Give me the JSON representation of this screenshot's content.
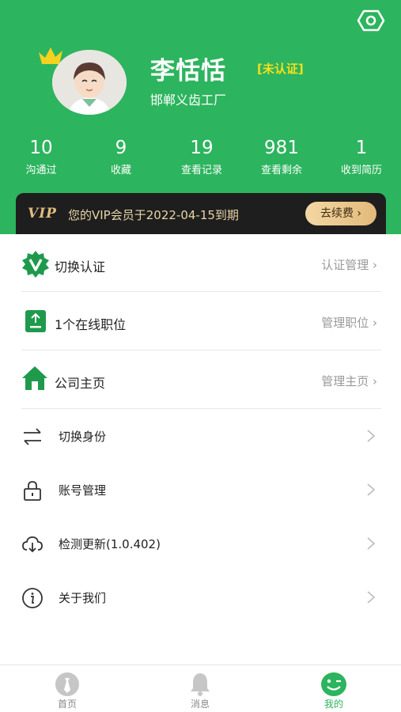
{
  "profile": {
    "name": "李恬恬",
    "cert_status": "[未认证]",
    "company": "邯郸义齿工厂"
  },
  "stats": [
    {
      "value": "10",
      "label": "沟通过"
    },
    {
      "value": "9",
      "label": "收藏"
    },
    {
      "value": "19",
      "label": "查看记录"
    },
    {
      "value": "981",
      "label": "查看剩余"
    },
    {
      "value": "1",
      "label": "收到简历"
    }
  ],
  "vip": {
    "logo": "VIP",
    "text": "您的VIP会员于2022-04-15到期",
    "renew_label": "去续费"
  },
  "menu_primary": [
    {
      "label": "切换认证",
      "right": "认证管理"
    },
    {
      "label": "1个在线职位",
      "right": "管理职位"
    },
    {
      "label": "公司主页",
      "right": "管理主页"
    }
  ],
  "menu_secondary": [
    {
      "label": "切换身份"
    },
    {
      "label": "账号管理"
    },
    {
      "label": "检测更新(1.0.402)"
    },
    {
      "label": "关于我们"
    }
  ],
  "tabs": [
    {
      "label": "首页"
    },
    {
      "label": "消息"
    },
    {
      "label": "我的"
    }
  ],
  "colors": {
    "brand_green": "#2db45e",
    "cert_yellow": "#f6df1c",
    "vip_gold": "#e0bd7f"
  }
}
